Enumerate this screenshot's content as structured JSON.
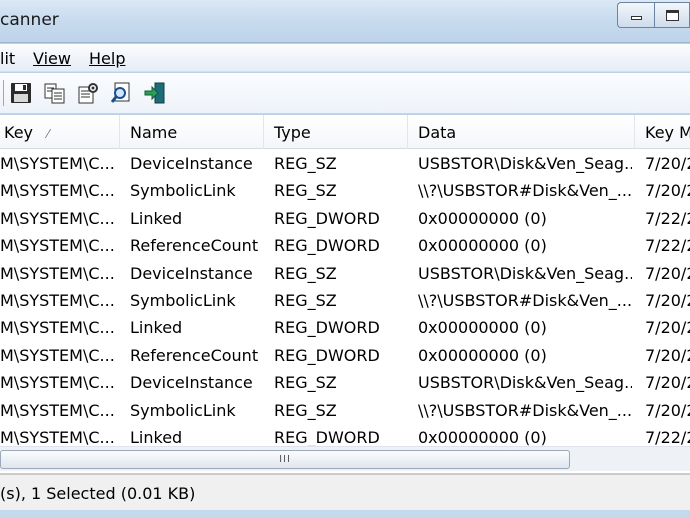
{
  "window": {
    "title": "canner",
    "minimize_icon": "minimize-icon",
    "maximize_icon": "maximize-icon"
  },
  "menu": {
    "edit": "lit",
    "view": "View",
    "help": "Help"
  },
  "toolbar": {
    "icons": [
      "save-icon",
      "copy-icon",
      "properties-icon",
      "find-icon",
      "exit-icon"
    ]
  },
  "columns": {
    "key": "Key",
    "name": "Name",
    "type": "Type",
    "data": "Data",
    "key_modified": "Key M"
  },
  "rows": [
    {
      "key": "M\\SYSTEM\\C...",
      "name": "DeviceInstance",
      "type": "REG_SZ",
      "data": "USBSTOR\\Disk&Ven_Seag...",
      "time": "7/20/2"
    },
    {
      "key": "M\\SYSTEM\\C...",
      "name": "SymbolicLink",
      "type": "REG_SZ",
      "data": "\\\\?\\USBSTOR#Disk&Ven_...",
      "time": "7/20/2"
    },
    {
      "key": "M\\SYSTEM\\C...",
      "name": "Linked",
      "type": "REG_DWORD",
      "data": "0x00000000 (0)",
      "time": "7/22/2"
    },
    {
      "key": "M\\SYSTEM\\C...",
      "name": "ReferenceCount",
      "type": "REG_DWORD",
      "data": "0x00000000 (0)",
      "time": "7/22/2"
    },
    {
      "key": "M\\SYSTEM\\C...",
      "name": "DeviceInstance",
      "type": "REG_SZ",
      "data": "USBSTOR\\Disk&Ven_Seag...",
      "time": "7/20/2"
    },
    {
      "key": "M\\SYSTEM\\C...",
      "name": "SymbolicLink",
      "type": "REG_SZ",
      "data": "\\\\?\\USBSTOR#Disk&Ven_...",
      "time": "7/20/2"
    },
    {
      "key": "M\\SYSTEM\\C...",
      "name": "Linked",
      "type": "REG_DWORD",
      "data": "0x00000000 (0)",
      "time": "7/20/2"
    },
    {
      "key": "M\\SYSTEM\\C...",
      "name": "ReferenceCount",
      "type": "REG_DWORD",
      "data": "0x00000000 (0)",
      "time": "7/20/2"
    },
    {
      "key": "M\\SYSTEM\\C...",
      "name": "DeviceInstance",
      "type": "REG_SZ",
      "data": "USBSTOR\\Disk&Ven_Seag...",
      "time": "7/20/2"
    },
    {
      "key": "M\\SYSTEM\\C...",
      "name": "SymbolicLink",
      "type": "REG_SZ",
      "data": "\\\\?\\USBSTOR#Disk&Ven_...",
      "time": "7/20/2"
    },
    {
      "key": "M\\SYSTEM\\C...",
      "name": "Linked",
      "type": "REG_DWORD",
      "data": "0x00000000 (0)",
      "time": "7/22/2"
    }
  ],
  "scrollbar": {
    "grip": "III"
  },
  "status": {
    "text": "(s), 1 Selected  (0.01 KB)"
  }
}
